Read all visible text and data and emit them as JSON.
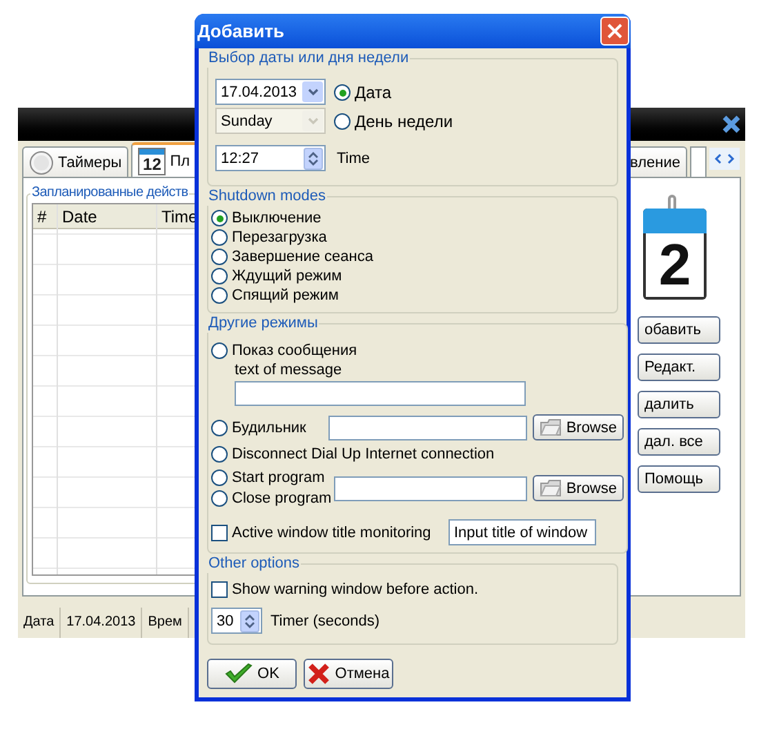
{
  "main_window": {
    "tabs": [
      {
        "label": "Таймеры",
        "selected": false
      },
      {
        "label": "Пл",
        "icon_text": "12",
        "selected": true
      },
      {
        "label": "вление",
        "selected": false
      }
    ],
    "group_title": "Запланированные действ",
    "table": {
      "columns": [
        "#",
        "Date",
        "Time"
      ]
    },
    "calendar_text": "2",
    "buttons": [
      "обавить",
      "Редакт.",
      "далить",
      "дал. все",
      "Помощь"
    ],
    "status_bar": [
      "Дата",
      "17.04.2013",
      "Врем"
    ]
  },
  "dialog": {
    "title": "Добавить",
    "date_group": {
      "title": "Выбор даты или дня недели",
      "date": "17.04.2013",
      "weekday": "Sunday",
      "options": [
        {
          "label": "Дата",
          "selected": true
        },
        {
          "label": "День недели",
          "selected": false
        }
      ],
      "time": "12:27",
      "time_label": "Time"
    },
    "shutdown_modes": {
      "title": "Shutdown modes",
      "options": [
        {
          "label": "Выключение",
          "selected": true
        },
        {
          "label": "Перезагрузка",
          "selected": false
        },
        {
          "label": "Завершение сеанса",
          "selected": false
        },
        {
          "label": "Ждущий режим",
          "selected": false
        },
        {
          "label": "Спящий режим",
          "selected": false
        }
      ]
    },
    "other_modes": {
      "title": "Другие режимы",
      "message": {
        "label": "Показ сообщения",
        "selected": false,
        "field_label": "text of message"
      },
      "alarm": {
        "label": "Будильник",
        "selected": false,
        "button": "Browse"
      },
      "disconnect": {
        "label": "Disconnect Dial Up Internet connection",
        "selected": false
      },
      "program": {
        "options": [
          {
            "label": "Start program",
            "selected": false
          },
          {
            "label": "Close program",
            "selected": false
          }
        ],
        "button": "Browse"
      },
      "monitoring": {
        "label": "Active window title monitoring",
        "checked": false,
        "value": "Input title of window"
      }
    },
    "other_options": {
      "title": "Other options",
      "warning": {
        "label": "Show warning window before action.",
        "checked": false
      },
      "timer": "30",
      "timer_label": "Timer (seconds)"
    },
    "buttons": [
      {
        "label": "OK",
        "kind": "ok"
      },
      {
        "label": "Отмена",
        "kind": "cancel"
      }
    ]
  }
}
